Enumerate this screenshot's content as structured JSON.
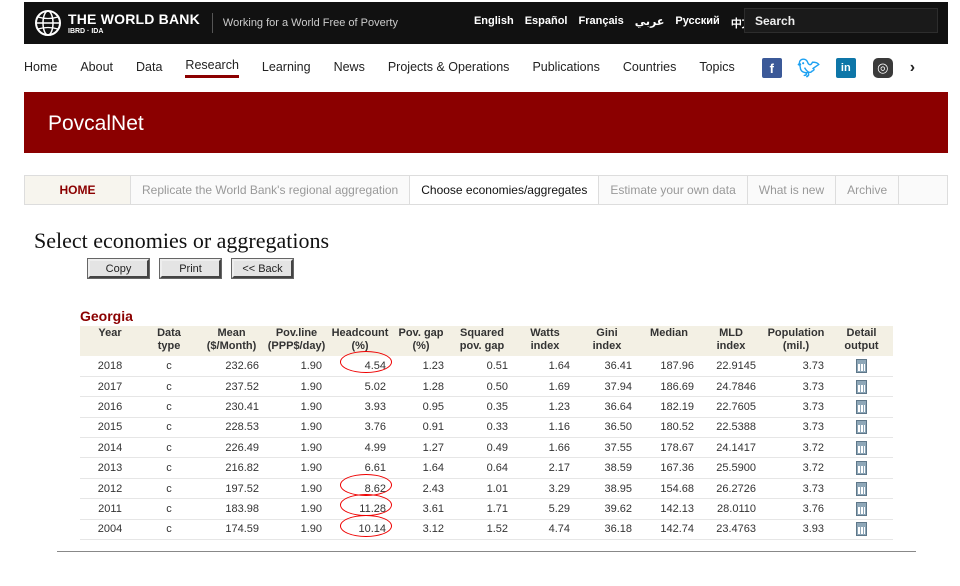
{
  "topbar": {
    "logo_main": "THE WORLD BANK",
    "logo_sub": "IBRD · IDA",
    "tagline": "Working for a World Free of Poverty",
    "languages": [
      "English",
      "Español",
      "Français",
      "عربي",
      "Русский",
      "中文"
    ],
    "search_placeholder": "Search"
  },
  "nav": {
    "items": [
      "Home",
      "About",
      "Data",
      "Research",
      "Learning",
      "News",
      "Projects & Operations",
      "Publications",
      "Countries",
      "Topics"
    ],
    "active": "Research",
    "social": [
      "facebook-icon",
      "twitter-icon",
      "linkedin-icon",
      "instagram-icon"
    ]
  },
  "banner": {
    "title": "PovcalNet",
    "color": "#8b0000"
  },
  "tabs": [
    "HOME",
    "Replicate the World Bank's regional aggregation",
    "Choose economies/aggregates",
    "Estimate your own data",
    "What is new",
    "Archive"
  ],
  "page": {
    "title": "Select economies or aggregations",
    "buttons": {
      "copy": "Copy",
      "print": "Print",
      "back": "<< Back"
    }
  },
  "table": {
    "country": "Georgia",
    "headers": [
      [
        "Year",
        ""
      ],
      [
        "Data",
        "type"
      ],
      [
        "Mean",
        "($/Month)"
      ],
      [
        "Pov.line",
        "(PPP$/day)"
      ],
      [
        "Headcount",
        "(%)"
      ],
      [
        "Pov. gap",
        "(%)"
      ],
      [
        "Squared",
        "pov. gap"
      ],
      [
        "Watts",
        "index"
      ],
      [
        "Gini",
        "index"
      ],
      [
        "Median",
        ""
      ],
      [
        "MLD",
        "index"
      ],
      [
        "Population",
        "(mil.)"
      ],
      [
        "Detail",
        "output"
      ]
    ],
    "rows": [
      [
        "2018",
        "c",
        "232.66",
        "1.90",
        "4.54",
        "1.23",
        "0.51",
        "1.64",
        "36.41",
        "187.96",
        "22.9145",
        "3.73"
      ],
      [
        "2017",
        "c",
        "237.52",
        "1.90",
        "5.02",
        "1.28",
        "0.50",
        "1.69",
        "37.94",
        "186.69",
        "24.7846",
        "3.73"
      ],
      [
        "2016",
        "c",
        "230.41",
        "1.90",
        "3.93",
        "0.95",
        "0.35",
        "1.23",
        "36.64",
        "182.19",
        "22.7605",
        "3.73"
      ],
      [
        "2015",
        "c",
        "228.53",
        "1.90",
        "3.76",
        "0.91",
        "0.33",
        "1.16",
        "36.50",
        "180.52",
        "22.5388",
        "3.73"
      ],
      [
        "2014",
        "c",
        "226.49",
        "1.90",
        "4.99",
        "1.27",
        "0.49",
        "1.66",
        "37.55",
        "178.67",
        "24.1417",
        "3.72"
      ],
      [
        "2013",
        "c",
        "216.82",
        "1.90",
        "6.61",
        "1.64",
        "0.64",
        "2.17",
        "38.59",
        "167.36",
        "25.5900",
        "3.72"
      ],
      [
        "2012",
        "c",
        "197.52",
        "1.90",
        "8.62",
        "2.43",
        "1.01",
        "3.29",
        "38.95",
        "154.68",
        "26.2726",
        "3.73"
      ],
      [
        "2011",
        "c",
        "183.98",
        "1.90",
        "11.28",
        "3.61",
        "1.71",
        "5.29",
        "39.62",
        "142.13",
        "28.0110",
        "3.76"
      ],
      [
        "2004",
        "c",
        "174.59",
        "1.90",
        "10.14",
        "3.12",
        "1.52",
        "4.74",
        "36.18",
        "142.74",
        "23.4763",
        "3.93"
      ]
    ],
    "circled_headcount_years": [
      "2018",
      "2012",
      "2011",
      "2004"
    ],
    "detail_icon": "calculator-icon"
  }
}
